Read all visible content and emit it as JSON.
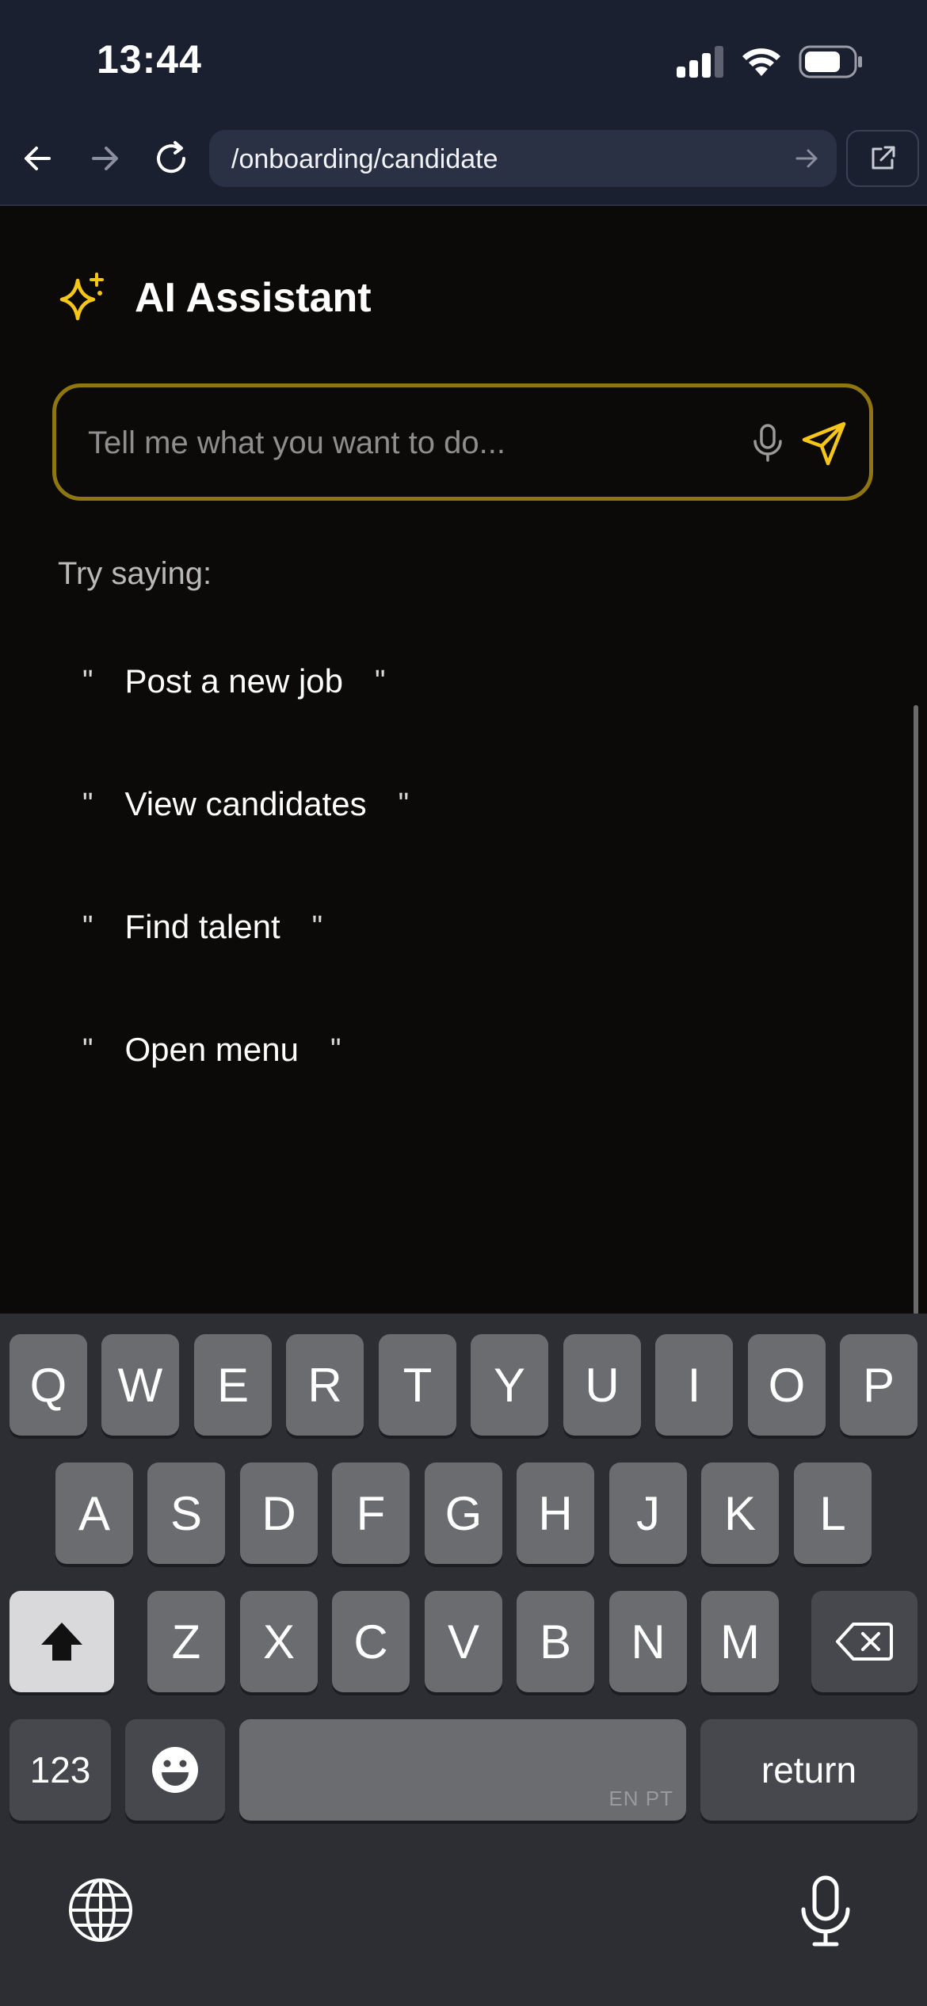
{
  "status_bar": {
    "time": "13:44",
    "icons": [
      "signal-icon",
      "wifi-icon",
      "battery-icon"
    ]
  },
  "browser": {
    "url": "/onboarding/candidate",
    "buttons": [
      "back-arrow-icon",
      "forward-arrow-icon",
      "reload-icon",
      "go-arrow-icon",
      "external-link-icon"
    ]
  },
  "header": {
    "title": "AI Assistant",
    "icon": "sparkle-icon"
  },
  "input": {
    "placeholder": "Tell me what you want to do...",
    "value": ""
  },
  "suggestions": {
    "label": "Try saying:",
    "open_quote": "\"",
    "close_quote": "\"",
    "items": [
      "Post a new job",
      "View candidates",
      "Find talent",
      "Open menu"
    ]
  },
  "keyboard": {
    "row1": [
      "Q",
      "W",
      "E",
      "R",
      "T",
      "Y",
      "U",
      "I",
      "O",
      "P"
    ],
    "row2": [
      "A",
      "S",
      "D",
      "F",
      "G",
      "H",
      "J",
      "K",
      "L"
    ],
    "row3": [
      "Z",
      "X",
      "C",
      "V",
      "B",
      "N",
      "M"
    ],
    "numbers_label": "123",
    "space_languages": "EN PT",
    "return_label": "return"
  },
  "colors": {
    "accent": "#f5c518",
    "input_border": "#8f7611",
    "chrome_background": "#1b2031",
    "page_background": "#0b0a09",
    "keyboard_background": "#2c2e33"
  }
}
